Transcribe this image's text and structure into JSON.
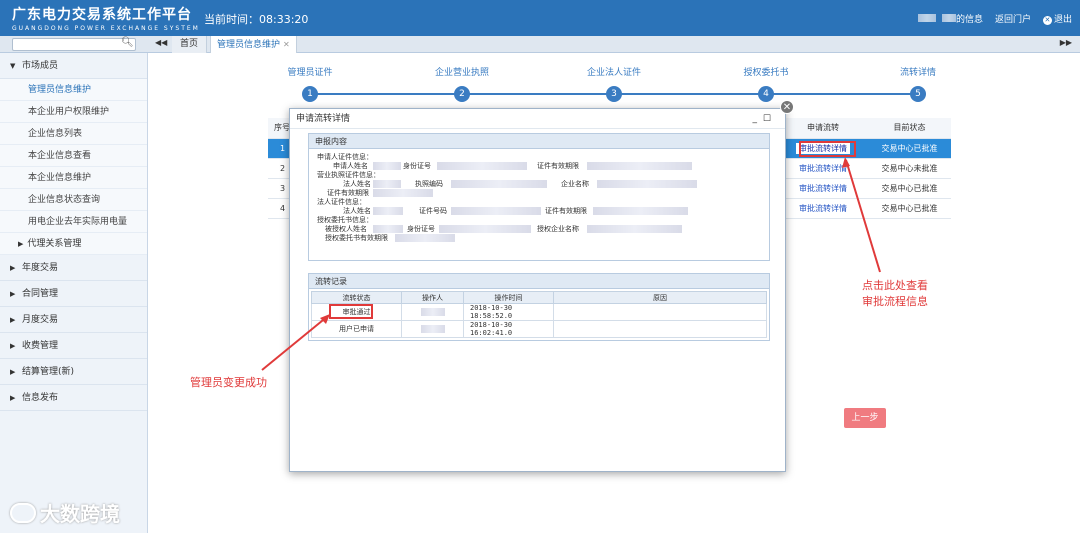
{
  "header": {
    "title": "广东电力交易系统工作平台",
    "subtitle": "GUANGDONG POWER EXCHANGE SYSTEM",
    "current_time": "当前时间：08:33:20",
    "my_info": "的信息",
    "return_portal": "返回门户",
    "logout": "退出",
    "bg_color": "#2b73b8"
  },
  "tabs": {
    "search_placeholder": "",
    "home": "首页",
    "active": "管理员信息维护",
    "close": "✕"
  },
  "sidebar": {
    "market_member": "市场成员",
    "sub_items": [
      "管理员信息维护",
      "本企业用户权限维护",
      "企业信息列表",
      "本企业信息查看",
      "本企业信息维护",
      "企业信息状态查询",
      "用电企业去年实际用电量"
    ],
    "agent_mgmt": "代理关系管理",
    "groups": [
      "年度交易",
      "合同管理",
      "月度交易",
      "收费管理",
      "结算管理(新)",
      "信息发布"
    ]
  },
  "watermark": "大数跨境",
  "steps": {
    "labels": [
      "管理员证件",
      "企业营业执照",
      "企业法人证件",
      "授权委托书",
      "流转详情"
    ],
    "numbers": [
      "1",
      "2",
      "3",
      "4",
      "5"
    ]
  },
  "bg_table": {
    "headers": [
      "序号",
      "申请流转",
      "目前状态"
    ],
    "rows": [
      {
        "no": "1",
        "link": "审批流转详情",
        "status": "交易中心已批准"
      },
      {
        "no": "2",
        "link": "审批流转详情",
        "status": "交易中心未批准"
      },
      {
        "no": "3",
        "link": "审批流转详情",
        "status": "交易中心已批准"
      },
      {
        "no": "4",
        "link": "审批流转详情",
        "status": "交易中心已批准"
      }
    ],
    "prev_button": "上一步"
  },
  "dialog": {
    "title": "申请流转详情",
    "declare_title": "申报内容",
    "applicant_cert": "申请人证件信息：",
    "applicant_name": "申请人姓名",
    "id_no": "身份证号",
    "cert_valid": "证件有效期限",
    "license_info": "营业执照证件信息：",
    "legal_name": "法人姓名",
    "license_code": "执照编码",
    "company_name": "企业名称",
    "legal_cert_info": "法人证件信息：",
    "cert_no": "证件号码",
    "auth_info": "授权委托书信息：",
    "grantee_name": "被授权人姓名",
    "auth_company": "授权企业名称",
    "auth_valid": "授权委托书有效期限",
    "flow_title": "流转记录",
    "flow_headers": [
      "流转状态",
      "操作人",
      "操作时间",
      "原因"
    ],
    "flow_rows": [
      {
        "status": "审批通过",
        "time": "2018-10-30 18:58:52.0"
      },
      {
        "status": "用户已申请",
        "time": "2018-10-30 16:02:41.0"
      }
    ]
  },
  "annotations": {
    "admin_changed": "管理员变更成功",
    "click_here_1": "点击此处查看",
    "click_here_2": "审批流程信息"
  }
}
